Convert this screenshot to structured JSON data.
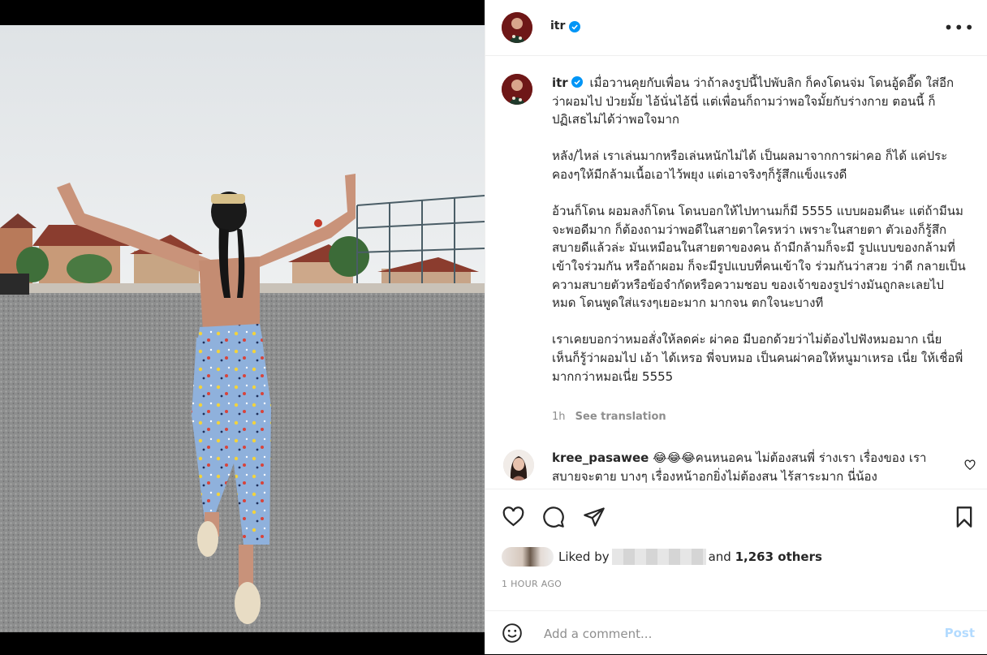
{
  "post": {
    "username": "itr",
    "more_icon": "more-horizontal-icon",
    "caption_paragraphs": [
      "เมื่อวานคุยกับเพื่อน ว่าถ้าลงรูปนี้ไปพับลิก ก็คงโดนจ่ม โดนอู้ดอี๊ด ใส่อีก ว่าผอมไป ป่วยมั้ย ไอ้นั่นไอ้นี่ แต่เพื่อนก็ถามว่าพอใจมั้ยกับร่างกาย ตอนนี้ ก็ปฏิเสธไม่ได้ว่าพอใจมาก",
      "หลัง/ไหล่ เราเล่นมากหรือเล่นหนักไม่ได้ เป็นผลมาจากการผ่าคอ ก็ได้ แค่ประคองๆให้มีกล้ามเนื้อเอาไว้พยุง แต่เอาจริงๆก็รู้สึกแข็งแรงดี",
      "อ้วนก็โดน ผอมลงก็โดน โดนบอกให้ไปทานมก็มี 5555 แบบผอมดีนะ แต่ถ้ามีนมจะพอดีมาก ก็ต้องถามว่าพอดีในสายตาใครหว่า เพราะในสายตา ตัวเองก็รู้สึกสบายดีแล้วล่ะ มันเหมือนในสายตาของคน ถ้ามีกล้ามก็จะมี รูปแบบของกล้ามที่เข้าใจร่วมกัน หรือถ้าผอม ก็จะมีรูปแบบที่คนเข้าใจ ร่วมกันว่าสวย ว่าดี กลายเป็นความสบายตัวหรือข้อจำกัดหรือความชอบ ของเจ้าของรูปร่างมันถูกละเลยไปหมด โดนพูดใส่แรงๆเยอะมาก มากจน ตกใจนะบางที",
      "เราเคยบอกว่าหมอสั่งให้ลดค่ะ ผ่าคอ มีบอกด้วยว่าไม่ต้องไปฟังหมอมาก เนี่ย เห็นก็รู้ว่าผอมไป เอ้า ได้เหรอ พี่จบหมอ เป็นคนผ่าคอให้หนูมาเหรอ เนี่ย ให้เชื่อพี่มากกว่าหมอเนี่ย 5555"
    ],
    "time_short": "1h",
    "see_translation": "See translation"
  },
  "comment": {
    "username": "kree_pasawee",
    "text": "😂😂😂คนหนอคน ไม่ต้องสนพี่ ร่างเรา เรื่องของ เรา สบายจะตาย บางๆ เรื่องหน้าอกยิ่งไม่ต้องสน ไร้สาระมาก นี่น้อง"
  },
  "likes": {
    "liked_by": "Liked by",
    "and_text": "and",
    "others": "1,263 others"
  },
  "timestamp": "1 HOUR AGO",
  "add_comment": {
    "placeholder": "Add a comment...",
    "post_label": "Post"
  },
  "colors": {
    "verified": "#0095f6",
    "post_disabled": "#b3dbff",
    "muted": "#8e8e8e"
  }
}
